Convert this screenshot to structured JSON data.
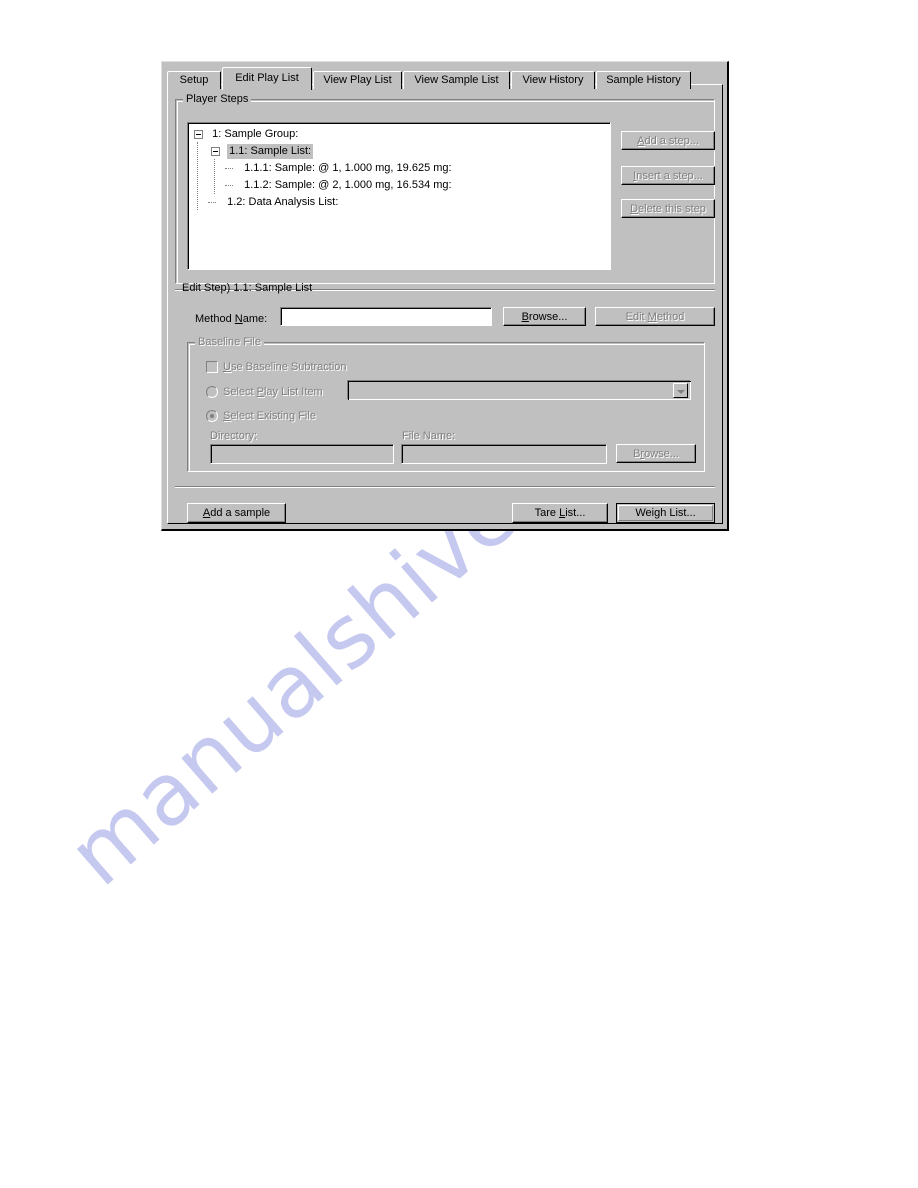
{
  "page": {
    "watermark": "manualshive.com",
    "watermark_color": "#c6c9ef",
    "background": "#ffffff"
  },
  "dialog": {
    "face_color": "#c0c0c0",
    "tabs": [
      {
        "label": "Setup",
        "active": false
      },
      {
        "label": "Edit Play List",
        "active": true
      },
      {
        "label": "View Play List",
        "active": false
      },
      {
        "label": "View Sample List",
        "active": false
      },
      {
        "label": "View History",
        "active": false
      },
      {
        "label": "Sample History",
        "active": false
      }
    ],
    "player_steps": {
      "title": "Player Steps",
      "tree": [
        {
          "label": "1: Sample Group:",
          "level": 0,
          "expander": true,
          "selected": false
        },
        {
          "label": "1.1: Sample List:",
          "level": 1,
          "expander": true,
          "selected": true
        },
        {
          "label": "1.1.1: Sample:  @ 1, 1.000 mg, 19.625 mg:",
          "level": 2,
          "expander": false,
          "selected": false
        },
        {
          "label": "1.1.2: Sample:  @ 2, 1.000 mg, 16.534 mg:",
          "level": 2,
          "expander": false,
          "selected": false
        },
        {
          "label": "1.2: Data Analysis List:",
          "level": 1,
          "expander": false,
          "selected": false
        }
      ],
      "buttons": [
        {
          "label": "Add a step...",
          "accel": "A",
          "disabled": true
        },
        {
          "label": "Insert a step...",
          "accel": "I",
          "disabled": true
        },
        {
          "label": "Delete this step",
          "accel": "D",
          "disabled": true
        }
      ]
    },
    "edit_step": {
      "header": "Edit Step)  1.1: Sample List",
      "method_label": "Method Name:",
      "method_accel": "N",
      "method_value": "",
      "browse_label": "Browse...",
      "browse_accel": "B",
      "edit_method_label": "Edit Method",
      "edit_method_accel": "M",
      "edit_method_disabled": true
    },
    "baseline_file": {
      "title": "Baseline File",
      "use_subtraction_label": "Use Baseline Subtraction",
      "use_subtraction_accel": "U",
      "use_subtraction_checked": false,
      "select_play_list_label": "Select Play List Item",
      "select_play_list_accel": "P",
      "select_play_list_checked": false,
      "play_list_combo_value": "",
      "select_existing_label": "Select Existing File",
      "select_existing_accel": "S",
      "select_existing_checked": true,
      "directory_label": "Directory:",
      "directory_value": "",
      "file_name_label": "File Name:",
      "file_name_value": "",
      "browse_label": "Browse...",
      "browse_accel": "r",
      "disabled": true
    },
    "footer": {
      "add_sample_label": "Add a sample",
      "add_sample_accel": "A",
      "tare_list_label": "Tare List...",
      "tare_list_accel": "L",
      "weigh_list_label": "Weigh List...",
      "weigh_list_default": true
    }
  }
}
